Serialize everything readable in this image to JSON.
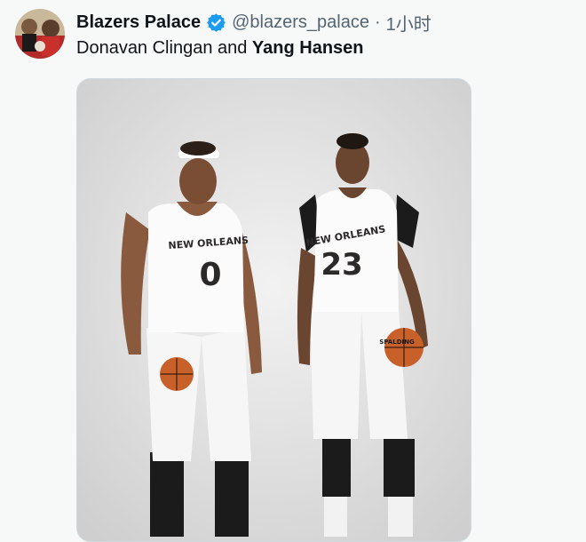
{
  "tweet": {
    "display_name": "Blazers Palace",
    "handle": "@blazers_palace",
    "separator": "·",
    "time": "1小时",
    "text_plain": "Donavan Clingan and ",
    "text_bold": "Yang Hansen"
  },
  "photo": {
    "player_left": {
      "team": "NEW ORLEANS",
      "number": "0"
    },
    "player_right": {
      "team": "NEW ORLEANS",
      "number": "23"
    },
    "ball_brand": "SPALDING"
  },
  "colors": {
    "verified": "#1d9bf0",
    "text_primary": "#0f1419",
    "text_secondary": "#536471"
  },
  "icons": {
    "verified": "verified-badge-icon"
  }
}
